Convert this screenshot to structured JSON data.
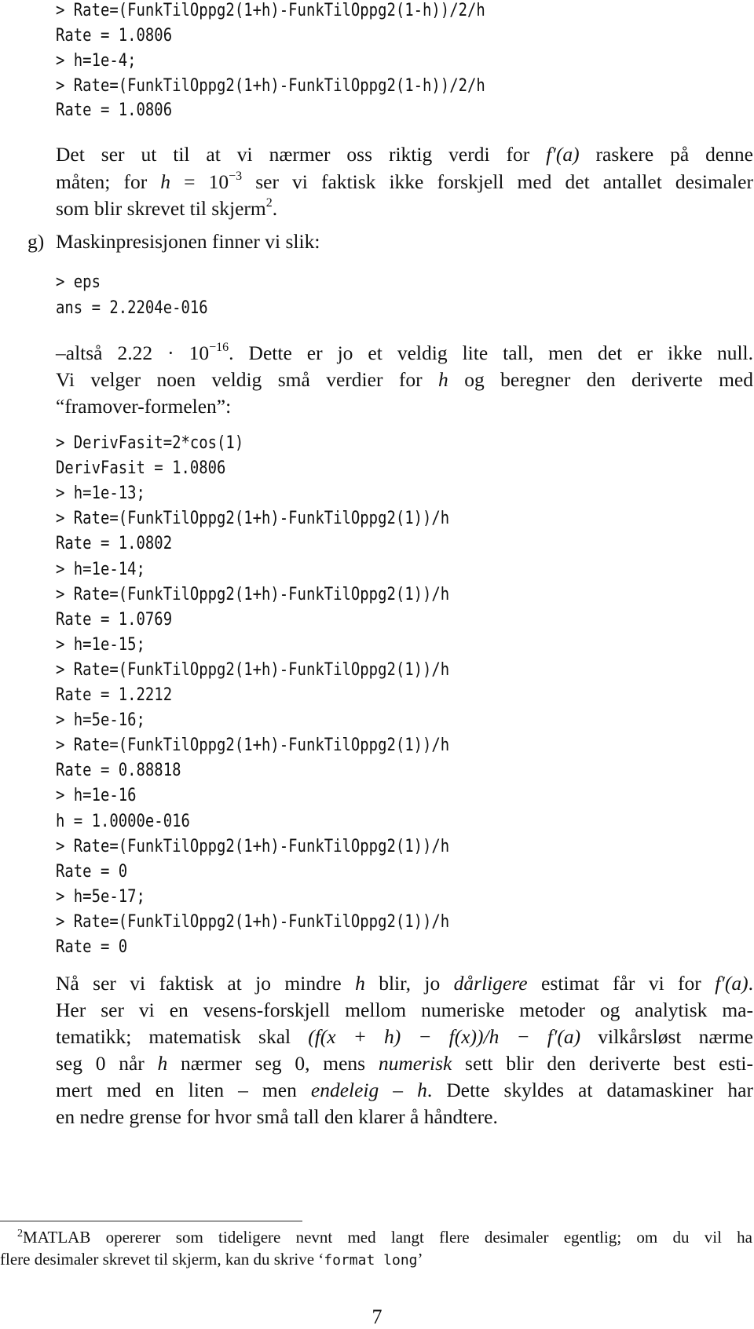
{
  "page_number": "7",
  "block1": {
    "lines": [
      "> Rate=(FunkTilOppg2(1+h)-FunkTilOppg2(1-h))/2/h",
      "Rate =  1.0806",
      "> h=1e-4;",
      "> Rate=(FunkTilOppg2(1+h)-FunkTilOppg2(1-h))/2/h",
      "Rate =  1.0806"
    ]
  },
  "para1": {
    "l1_a": "Det ser ut til at vi nærmer oss riktig verdi for ",
    "l1_math": "f′(a)",
    "l1_b": " raskere på denne",
    "l2_a": "måten; for ",
    "l2_math_h": "h",
    "l2_eq": " = 10",
    "l2_exp": "−3",
    "l2_b": " ser vi faktisk ikke forskjell med det antallet desimaler",
    "l3_a": "som blir skrevet til skjerm",
    "l3_sup": "2",
    "l3_b": "."
  },
  "item_g": {
    "label": "g)",
    "text": "Maskinpresisjonen finner vi slik:"
  },
  "block2": {
    "lines": [
      "> eps",
      "ans = 2.2204e-016"
    ]
  },
  "para2": {
    "l1_a": "–altså 2.22 · 10",
    "l1_exp": "−16",
    "l1_b": ". Dette er jo et veldig lite tall, men det er ikke null.",
    "l2_a": "Vi velger noen veldig små verdier for ",
    "l2_math_h": "h",
    "l2_b": " og beregner den deriverte med",
    "l3": "“framover-formelen”:"
  },
  "block3": {
    "lines": [
      "> DerivFasit=2*cos(1)",
      "DerivFasit =  1.0806",
      "> h=1e-13;",
      "> Rate=(FunkTilOppg2(1+h)-FunkTilOppg2(1))/h",
      "Rate =  1.0802",
      "> h=1e-14;",
      "> Rate=(FunkTilOppg2(1+h)-FunkTilOppg2(1))/h",
      "Rate =  1.0769",
      "> h=1e-15;",
      "> Rate=(FunkTilOppg2(1+h)-FunkTilOppg2(1))/h",
      "Rate =  1.2212",
      "> h=5e-16;",
      "> Rate=(FunkTilOppg2(1+h)-FunkTilOppg2(1))/h",
      "Rate =  0.88818",
      "> h=1e-16",
      "h = 1.0000e-016",
      "> Rate=(FunkTilOppg2(1+h)-FunkTilOppg2(1))/h",
      "Rate = 0",
      "> h=5e-17;",
      "> Rate=(FunkTilOppg2(1+h)-FunkTilOppg2(1))/h",
      "Rate = 0"
    ]
  },
  "para3": {
    "l1_a": "Nå ser vi faktisk at jo mindre ",
    "l1_h": "h",
    "l1_b": " blir, jo ",
    "l1_em": "dårligere",
    "l1_c": " estimat får vi for ",
    "l1_math": "f′(a)",
    "l1_d": ".",
    "l2": "Her ser vi en vesens-forskjell mellom numeriske metoder og analytisk ma-",
    "l3_a": "tematikk; matematisk skal ",
    "l3_math": "(f(x + h) − f(x))/h − f′(a)",
    "l3_b": " vilkårsløst nærme",
    "l4_a": "seg 0 når ",
    "l4_h": "h",
    "l4_b": " nærmer seg 0, mens ",
    "l4_em": "numerisk",
    "l4_c": " sett blir den deriverte best esti-",
    "l5_a": "mert med en liten – men ",
    "l5_em": "endeleig",
    "l5_b": " – ",
    "l5_h": "h",
    "l5_c": ". Dette skyldes at datamaskiner har",
    "l6": "en nedre grense for hvor små tall den klarer å håndtere."
  },
  "footnote": {
    "mark": "2",
    "l1": "MATLAB opererer som tideligere nevnt med langt flere desimaler egentlig; om du vil ha",
    "l2_a": "flere desimaler skrevet til skjerm, kan du skrive ‘",
    "l2_code": "format long",
    "l2_b": "’"
  }
}
